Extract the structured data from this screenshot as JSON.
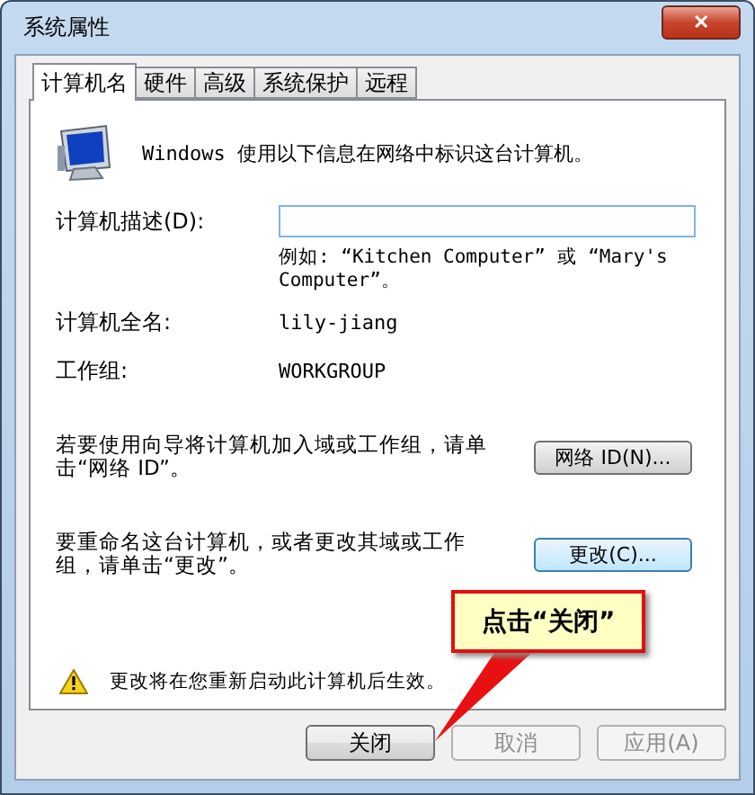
{
  "window": {
    "title": "系统属性",
    "close": "✕"
  },
  "tabs": [
    {
      "label": "计算机名",
      "selected": true
    },
    {
      "label": "硬件",
      "selected": false
    },
    {
      "label": "高级",
      "selected": false
    },
    {
      "label": "系统保护",
      "selected": false
    },
    {
      "label": "远程",
      "selected": false
    }
  ],
  "intro": "Windows 使用以下信息在网络中标识这台计算机。",
  "description": {
    "label": "计算机描述(D):",
    "hint": "例如: “Kitchen Computer” 或 “Mary's Computer”。"
  },
  "info": [
    {
      "label": "计算机全名:",
      "value": "lily-jiang"
    },
    {
      "label": "工作组:",
      "value": "WORKGROUP"
    }
  ],
  "actions": [
    {
      "text": "若要使用向导将计算机加入域或工作组，请单击“网络 ID”。",
      "button": "网络 ID(N)...",
      "focused": false
    },
    {
      "text": "要重命名这台计算机，或者更改其域或工作组，请单击“更改”。",
      "button": "更改(C)...",
      "focused": true
    }
  ],
  "warning": "更改将在您重新启动此计算机后生效。",
  "buttons": [
    {
      "label": "关闭",
      "disabled": false
    },
    {
      "label": "取消",
      "disabled": true
    },
    {
      "label": "应用(A)",
      "disabled": true
    }
  ],
  "callout": "点击“关闭”"
}
